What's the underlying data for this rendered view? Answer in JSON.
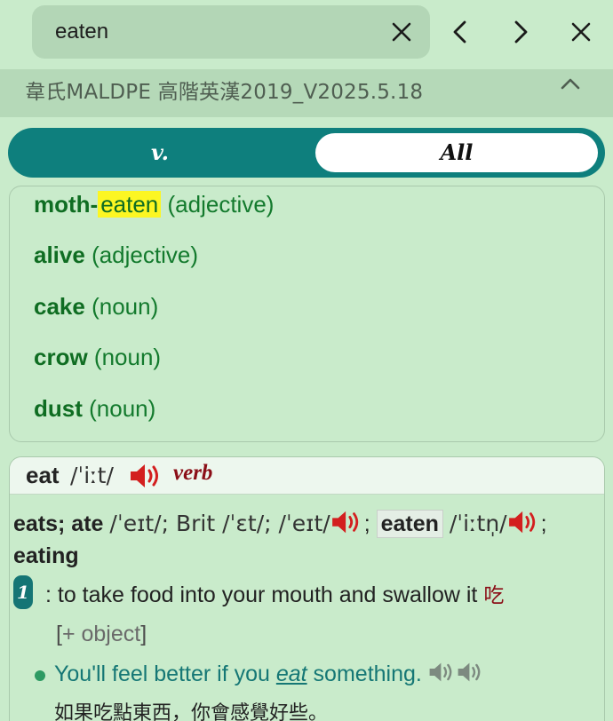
{
  "search": {
    "query": "eaten"
  },
  "dictionary": {
    "name": "韋氏MALDPE 高階英漢2019_V2025.5.18"
  },
  "pos_tabs": [
    {
      "label": "v.",
      "selected": false
    },
    {
      "label": "All",
      "selected": true
    }
  ],
  "related": [
    {
      "head_prefix": "moth-",
      "head_highlight": "eaten",
      "pos": "(adjective)"
    },
    {
      "head": "alive",
      "pos": "(adjective)"
    },
    {
      "head": "cake",
      "pos": "(noun)"
    },
    {
      "head": "crow",
      "pos": "(noun)"
    },
    {
      "head": "dust",
      "pos": "(noun)"
    }
  ],
  "entry": {
    "headword": "eat",
    "pron": "/ˈiːt/",
    "pos": "verb",
    "inflections": {
      "form1": "eats; ate",
      "pron1": "/ˈeɪt/; Brit /ˈɛt/; /ˈeɪt/",
      "form2": "eaten",
      "pron2": "/ˈiːtn̩/",
      "form3": "eating"
    },
    "sense": {
      "number": "1",
      "definition": ": to take food into your mouth and swallow it",
      "chinese": "吃",
      "grammar_open": "[",
      "grammar": "+ object",
      "grammar_close": "]",
      "example_pre": "You'll feel better if you ",
      "example_kw": "eat",
      "example_post": " something.",
      "translation": "如果吃點東西，你會感覺好些。"
    }
  },
  "colors": {
    "background": "#c9ebcb",
    "accent_teal": "#0e7f7d",
    "headword_green": "#137a2d",
    "pos_red": "#8b0e17",
    "highlight": "#fcf622"
  }
}
